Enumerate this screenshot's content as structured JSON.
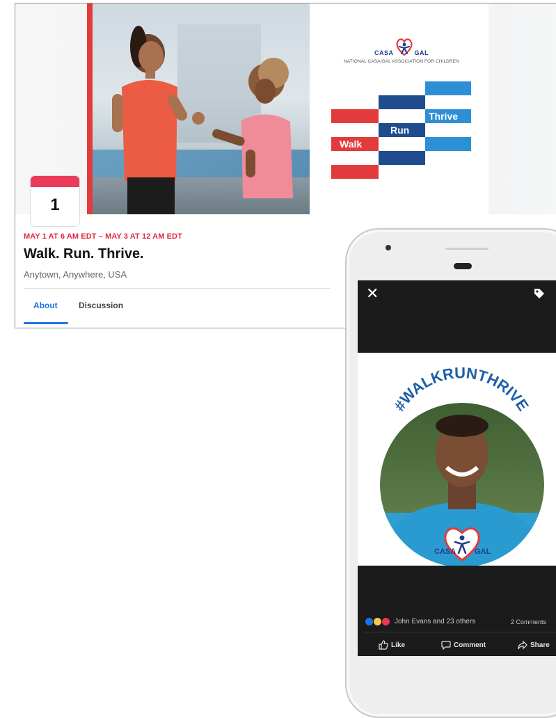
{
  "event": {
    "date_day": "1",
    "date_line": "MAY 1 AT 6 AM EDT – MAY 3 AT 12 AM EDT",
    "title": "Walk. Run. Thrive.",
    "location": "Anytown, Anywhere, USA",
    "tabs": [
      {
        "label": "About",
        "active": true
      },
      {
        "label": "Discussion",
        "active": false
      }
    ],
    "logo": {
      "left_word": "CASA",
      "right_word": "GAL",
      "org_name": "NATIONAL CASA/GAL ASSOCIATION FOR CHILDREN"
    },
    "graphic_words": [
      "Walk",
      "Run",
      "Thrive"
    ],
    "colors": {
      "accent_red": "#e23b3b",
      "date_red": "#e0293f",
      "navy": "#1f4c8f",
      "blue": "#2f8fd6",
      "tab_blue": "#1b74e4"
    }
  },
  "phone": {
    "close_icon": "close-icon",
    "tag_icon": "tag-icon",
    "hashtag": "#WALKRUNTHRIVE",
    "frame_logo": {
      "left_word": "CASA",
      "right_word": "GAL"
    },
    "reactions_text": "John Evans and 23 others",
    "comments_text": "2 Comments",
    "actions": [
      {
        "label": "Like",
        "icon": "thumbs-up-icon"
      },
      {
        "label": "Comment",
        "icon": "comment-icon"
      },
      {
        "label": "Share",
        "icon": "share-icon"
      }
    ]
  }
}
